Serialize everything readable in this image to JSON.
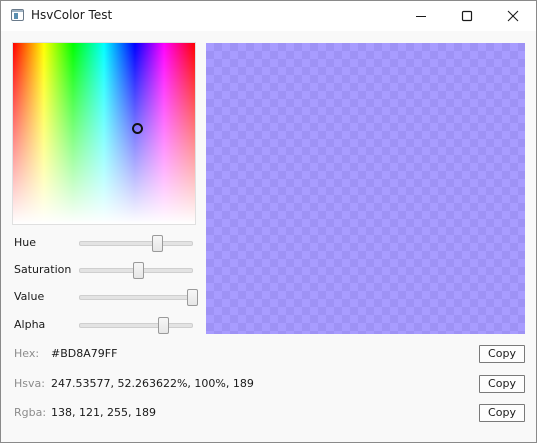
{
  "window": {
    "title": "HsvColor Test"
  },
  "colors": {
    "preview": "#BD8A79FF"
  },
  "picker": {
    "hue": 247.53577,
    "saturation": 0.5226,
    "value": 1.0,
    "alpha": 189
  },
  "sliders": [
    {
      "label": "Hue",
      "level": 0.69
    },
    {
      "label": "Saturation",
      "level": 0.52
    },
    {
      "label": "Value",
      "level": 1.0
    },
    {
      "label": "Alpha",
      "level": 0.74
    }
  ],
  "info": [
    {
      "label": "Hex:",
      "value": "#BD8A79FF",
      "button": "Copy"
    },
    {
      "label": "Hsva:",
      "value": "247.53577, 52.263622%, 100%, 189",
      "button": "Copy"
    },
    {
      "label": "Rgba:",
      "value": "138, 121, 255, 189",
      "button": "Copy"
    }
  ]
}
